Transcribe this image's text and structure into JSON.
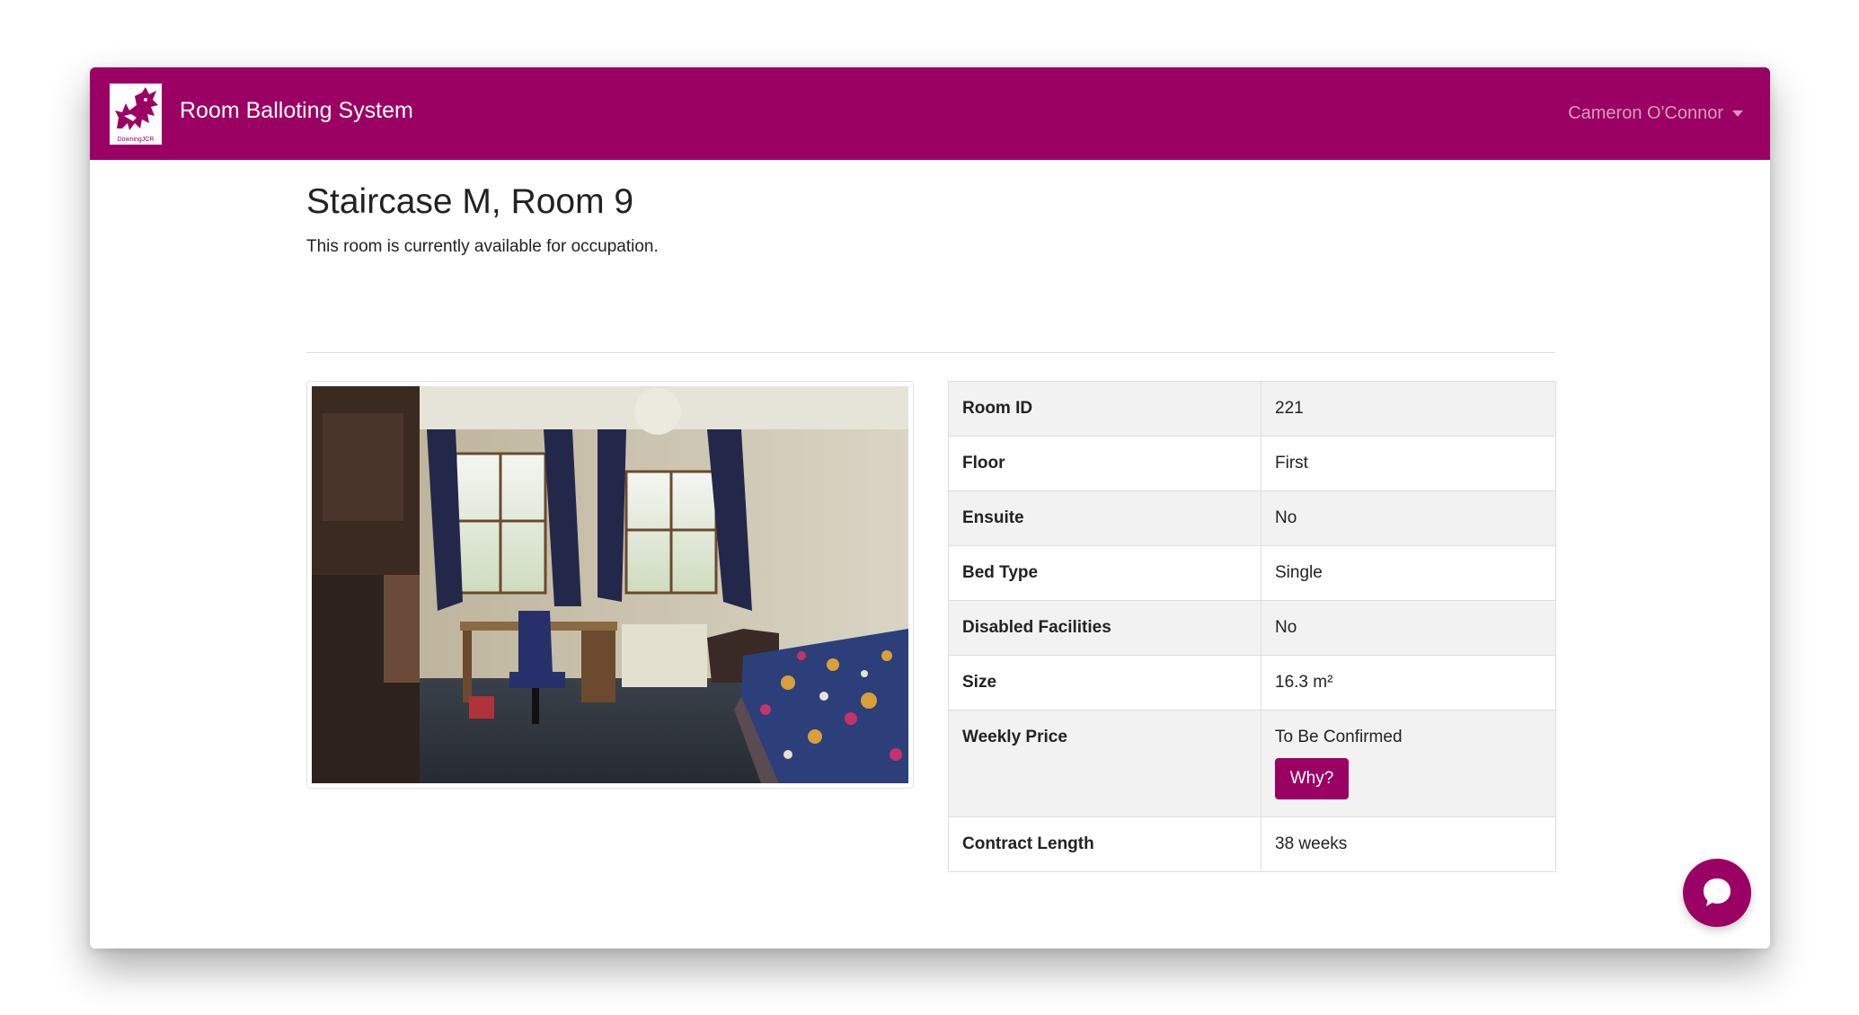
{
  "header": {
    "app_title": "Room Balloting System",
    "logo_caption": "DowningJCR",
    "user_name": "Cameron O'Connor"
  },
  "room": {
    "title": "Staircase M, Room 9",
    "status_text": "This room is currently available for occupation.",
    "photo_alt": "Room photo",
    "details": [
      {
        "label": "Room ID",
        "value": "221"
      },
      {
        "label": "Floor",
        "value": "First"
      },
      {
        "label": "Ensuite",
        "value": "No"
      },
      {
        "label": "Bed Type",
        "value": "Single"
      },
      {
        "label": "Disabled Facilities",
        "value": "No"
      },
      {
        "label": "Size",
        "value": "16.3 m²"
      },
      {
        "label": "Weekly Price",
        "value": "To Be Confirmed",
        "button_label": "Why?"
      },
      {
        "label": "Contract Length",
        "value": "38 weeks"
      }
    ]
  },
  "colors": {
    "brand": "#9b0063",
    "table_stripe": "#f2f2f2"
  },
  "icons": {
    "chat": "chat-bubble-icon",
    "dropdown": "chevron-down-icon"
  }
}
